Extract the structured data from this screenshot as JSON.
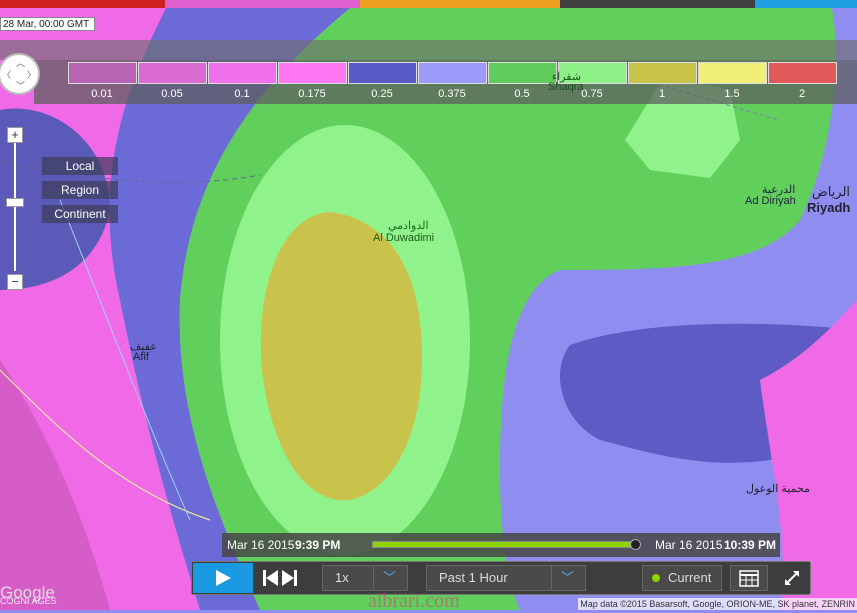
{
  "window": {
    "date_stamp": "28 Mar, 00:00 GMT"
  },
  "legend": {
    "ticks": [
      "0.01",
      "0.05",
      "0.1",
      "0.175",
      "0.25",
      "0.375",
      "0.5",
      "0.75",
      "1",
      "1.5",
      "2"
    ],
    "colors": [
      "#b864b4",
      "#d86ad2",
      "#f070ec",
      "#ff77f2",
      "#5a5ac8",
      "#9a9af8",
      "#5fcc5c",
      "#8ff288",
      "#c8c44a",
      "#f0ee74",
      "#e05a5a"
    ]
  },
  "map_controls": {
    "zoom_in": "+",
    "zoom_out": "−",
    "scale_local": "Local",
    "scale_region": "Region",
    "scale_continent": "Continent"
  },
  "places": {
    "shaqra_ar": "شقراء",
    "shaqra": "Shaqra",
    "duwadimi_ar": "الدوادمي",
    "duwadimi": "Al Duwadimi",
    "diriyah_ar": "الدرعية",
    "diriyah": "Ad Diriyah",
    "riyadh_ar": "الرياض",
    "riyadh": "Riyadh",
    "afif_ar": "عفيف",
    "afif": "Afif",
    "wuool_ar": "محمية الوعول"
  },
  "timeline": {
    "start_date": "Mar 16 2015",
    "start_time": "9:39 PM",
    "end_date": "Mar 16 2015",
    "end_time": "10:39 PM",
    "progress": 1.0
  },
  "controls": {
    "speed": "1x",
    "range": "Past 1 Hour",
    "current": "Current"
  },
  "footer": {
    "google": "Google",
    "imagery": "COGNI AGES",
    "credits": "Map data ©2015 Basarsoft, Google, ORION-ME, SK planet, ZENRIN",
    "watermark": "albrari.com"
  },
  "colors": {
    "accent": "#1a9ae0",
    "progress": "#8fd400"
  }
}
